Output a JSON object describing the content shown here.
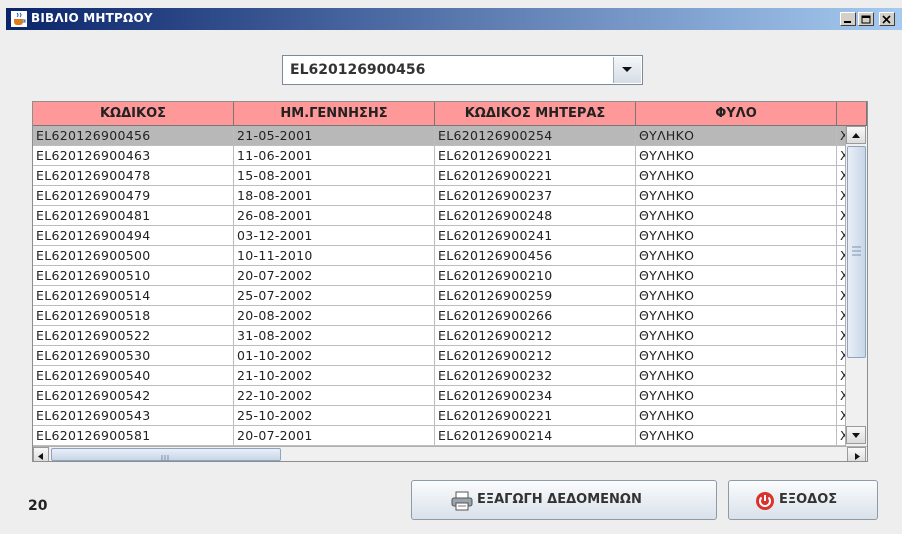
{
  "window": {
    "title": "ΒΙΒΛΙΟ ΜΗΤΡΩΟΥ",
    "title_icon": "java-cup-icon",
    "buttons": [
      "minimize-icon",
      "maximize-icon",
      "close-icon"
    ]
  },
  "selector": {
    "selected": "EL620126900456",
    "arrow_icon": "chevron-down-icon"
  },
  "table": {
    "columns": [
      "ΚΩΔΙΚΟΣ",
      "ΗΜ.ΓΕΝΝΗΣΗΣ",
      "ΚΩΔΙΚΟΣ ΜΗΤΕΡΑΣ",
      "ΦΥΛΟ",
      ""
    ],
    "header_color": "#ff9999",
    "selected_row_index": 0,
    "rows": [
      [
        "EL620126900456",
        "21-05-2001",
        "EL620126900254",
        "ΘΥΛΗΚΟ",
        "ΧΟ"
      ],
      [
        "EL620126900463",
        "11-06-2001",
        "EL620126900221",
        "ΘΥΛΗΚΟ",
        "ΧΟ"
      ],
      [
        "EL620126900478",
        "15-08-2001",
        "EL620126900221",
        "ΘΥΛΗΚΟ",
        "ΧΟ"
      ],
      [
        "EL620126900479",
        "18-08-2001",
        "EL620126900237",
        "ΘΥΛΗΚΟ",
        "ΧΟ"
      ],
      [
        "EL620126900481",
        "26-08-2001",
        "EL620126900248",
        "ΘΥΛΗΚΟ",
        "ΧΟ"
      ],
      [
        "EL620126900494",
        "03-12-2001",
        "EL620126900241",
        "ΘΥΛΗΚΟ",
        "ΧΟ"
      ],
      [
        "EL620126900500",
        "10-11-2010",
        "EL620126900456",
        "ΘΥΛΗΚΟ",
        "ΧΟ"
      ],
      [
        "EL620126900510",
        "20-07-2002",
        "EL620126900210",
        "ΘΥΛΗΚΟ",
        "ΧΟ"
      ],
      [
        "EL620126900514",
        "25-07-2002",
        "EL620126900259",
        "ΘΥΛΗΚΟ",
        "ΧΟ"
      ],
      [
        "EL620126900518",
        "20-08-2002",
        "EL620126900266",
        "ΘΥΛΗΚΟ",
        "ΧΟ"
      ],
      [
        "EL620126900522",
        "31-08-2002",
        "EL620126900212",
        "ΘΥΛΗΚΟ",
        "ΧΟ"
      ],
      [
        "EL620126900530",
        "01-10-2002",
        "EL620126900212",
        "ΘΥΛΗΚΟ",
        "ΧΟ"
      ],
      [
        "EL620126900540",
        "21-10-2002",
        "EL620126900232",
        "ΘΥΛΗΚΟ",
        "ΧΟ"
      ],
      [
        "EL620126900542",
        "22-10-2002",
        "EL620126900234",
        "ΘΥΛΗΚΟ",
        "ΧΟ"
      ],
      [
        "EL620126900543",
        "25-10-2002",
        "EL620126900221",
        "ΘΥΛΗΚΟ",
        "ΧΟ"
      ],
      [
        "EL620126900581",
        "20-07-2001",
        "EL620126900214",
        "ΘΥΛΗΚΟ",
        "ΧΟ"
      ]
    ]
  },
  "footer": {
    "count": "20",
    "export_label": "ΕΞΑΓΩΓΗ ΔΕΔΟΜΕΝΩΝ",
    "export_icon": "printer-icon",
    "exit_label": "ΕΞΟΔΟΣ",
    "exit_icon": "exit-icon"
  }
}
